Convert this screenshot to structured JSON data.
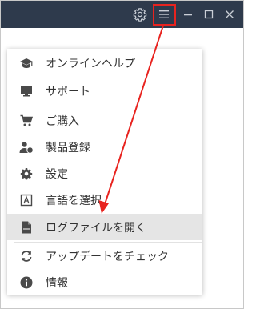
{
  "titlebar": {
    "background": "#2e3a4c",
    "buttons": [
      {
        "icon": "gear-icon"
      },
      {
        "icon": "hamburger-menu-icon"
      },
      {
        "icon": "minimize-icon"
      },
      {
        "icon": "maximize-icon"
      },
      {
        "icon": "close-icon"
      }
    ]
  },
  "menu": {
    "items": [
      {
        "label": "オンラインヘルプ",
        "icon": "graduation-cap-icon"
      },
      {
        "label": "サポート",
        "icon": "monitor-icon"
      },
      {
        "label": "ご購入",
        "icon": "cart-icon"
      },
      {
        "label": "製品登録",
        "icon": "user-add-icon"
      },
      {
        "label": "設定",
        "icon": "gear-icon"
      },
      {
        "label": "言語を選択",
        "icon": "language-icon"
      },
      {
        "label": "ログファイルを開く",
        "icon": "file-icon",
        "highlighted": true
      },
      {
        "label": "アップデートをチェック",
        "icon": "refresh-icon"
      },
      {
        "label": "情報",
        "icon": "info-icon"
      }
    ]
  },
  "annotation": {
    "color": "#e8231f"
  }
}
